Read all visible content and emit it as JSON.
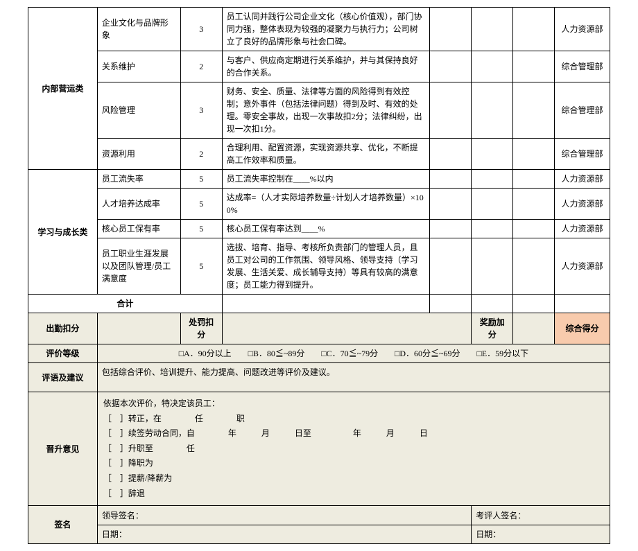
{
  "categories": {
    "internal_ops": "内部营运类",
    "learning": "学习与成长类"
  },
  "rows": [
    {
      "item": "企业文化与品牌形象",
      "weight": "3",
      "std": "员工认同并践行公司企业文化（核心价值观），部门协同力强，整体表现为较强的凝聚力与执行力；公司树立了良好的品牌形象与社会口碑。",
      "dept": "人力资源部"
    },
    {
      "item": "关系维护",
      "weight": "2",
      "std": "与客户、供应商定期进行关系维护，并与其保持良好的合作关系。",
      "dept": "综合管理部"
    },
    {
      "item": "风险管理",
      "weight": "3",
      "std": "财务、安全、质量、法律等方面的风险得到有效控制；意外事件（包括法律问题）得到及时、有效的处理。零安全事故，出现一次事故扣2分；法律纠纷，出现一次扣1分。",
      "dept": "综合管理部"
    },
    {
      "item": "资源利用",
      "weight": "2",
      "std": "合理利用、配置资源，实现资源共享、优化，不断提高工作效率和质量。",
      "dept": "综合管理部"
    },
    {
      "item": "员工流失率",
      "weight": "5",
      "std": "员工流失率控制在＿＿%以内",
      "dept": "人力资源部"
    },
    {
      "item": "人才培养达成率",
      "weight": "5",
      "std": "达成率=（人才实际培养数量÷计划人才培养数量）×100%",
      "dept": "人力资源部"
    },
    {
      "item": "核心员工保有率",
      "weight": "5",
      "std": "核心员工保有率达到＿＿%",
      "dept": "人力资源部"
    },
    {
      "item": "员工职业生涯发展以及团队管理/员工满意度",
      "weight": "5",
      "std": "选拔、培育、指导、考核所负责部门的管理人员，且员工对公司的工作氛围、领导风格、领导支持（学习发展、生活关爱、成长辅导支持）等具有较高的满意度；员工能力得到提升。",
      "dept": "人力资源部"
    }
  ],
  "total_label": "合计",
  "deduct": {
    "attendance": "出勤扣分",
    "penalty": "处罚扣分",
    "reward": "奖励加分",
    "score": "综合得分"
  },
  "rating": {
    "label": "评价等级",
    "options": "□A．90分以上　　□B．80≦~89分　　□C．70≦~79分　　□D．60分≦~69分　　□E．59分以下"
  },
  "comment": {
    "label": "评语及建议",
    "text": "包括综合评价、培训提升、能力提高、问题改进等评价及建议。"
  },
  "promote": {
    "label": "晋升意见",
    "line1": "依据本次评价，特决定该员工：",
    "line2": "［　］转正，在　　　　任　　　　职",
    "line3": "［　］续签劳动合同，自　　　　年　　　月　　　日至　　　　　年　　　月　　　日",
    "line4": "［　］升职至　　　　任",
    "line5": "［　］降职为",
    "line6": "［　］提薪/降薪为",
    "line7": "［　］辞退"
  },
  "sign": {
    "label": "签名",
    "leader": "领导签名：",
    "reviewer": "考评人签名：",
    "date": "日期："
  }
}
